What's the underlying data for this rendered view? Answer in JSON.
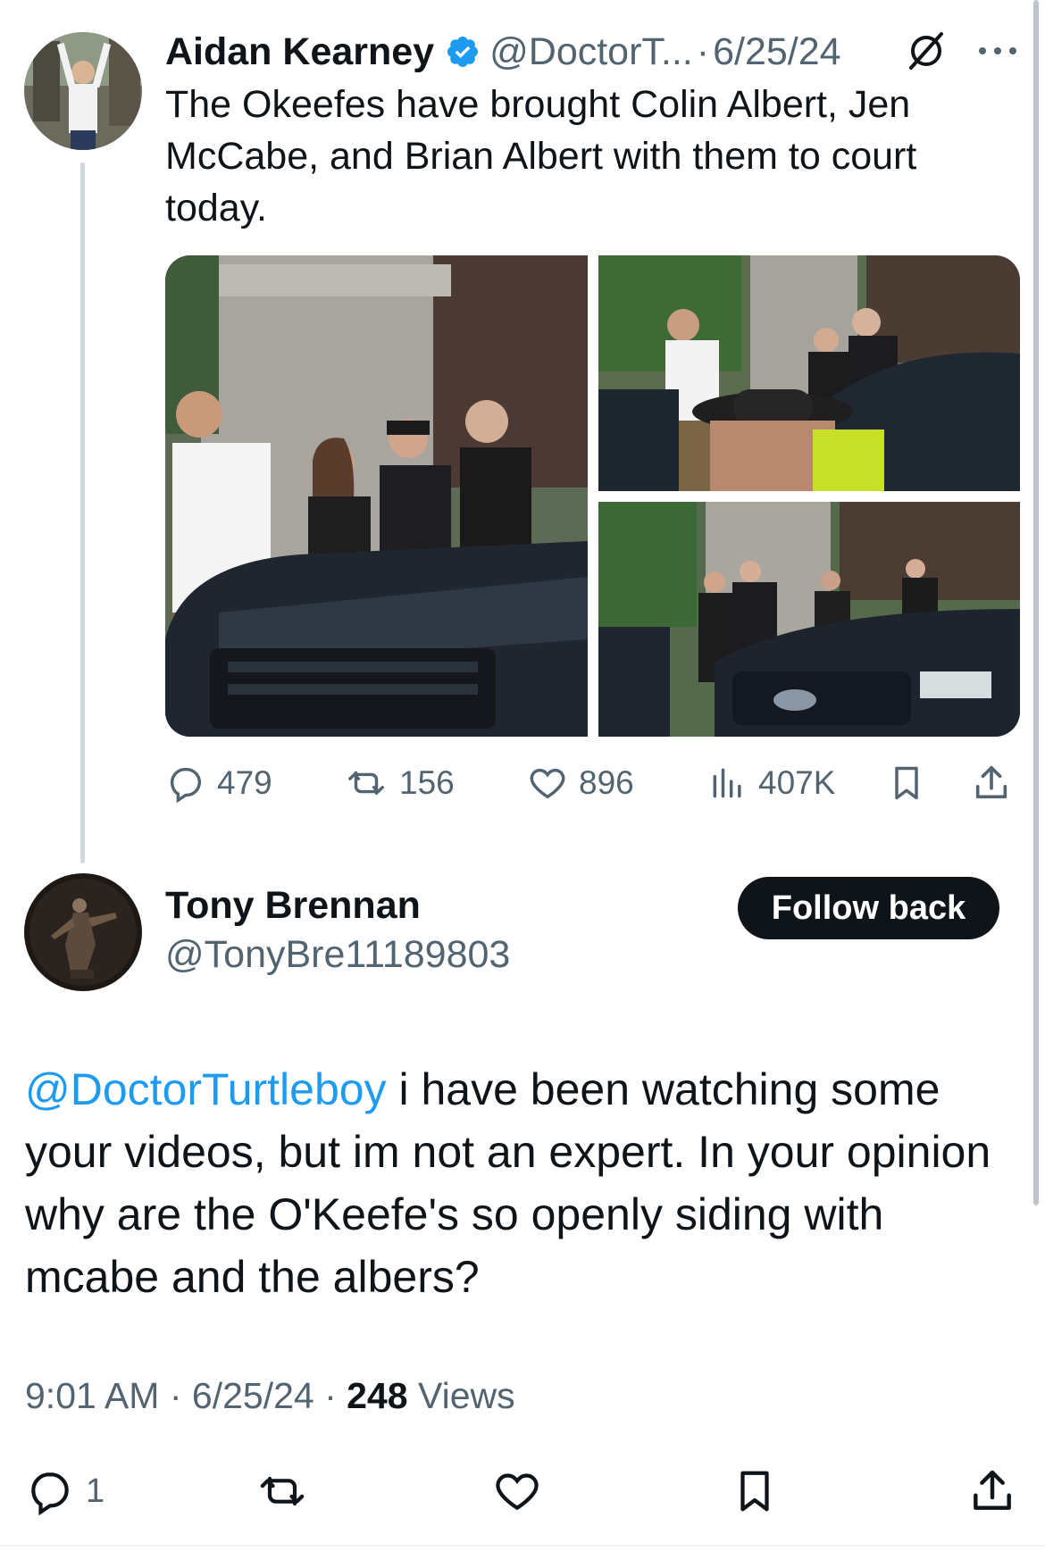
{
  "tweet": {
    "author_name": "Aidan Kearney",
    "handle": "@DoctorT...",
    "separator": "·",
    "date": "6/25/24",
    "text": "The Okeefes have brought Colin Albert, Jen McCabe, and Brian Albert with them to court today.",
    "stats": {
      "replies": "479",
      "reposts": "156",
      "likes": "896",
      "views": "407K"
    }
  },
  "reply": {
    "author_name": "Tony Brennan",
    "handle": "@TonyBre11189803",
    "follow_label": "Follow back",
    "mention": "@DoctorTurtleboy",
    "text": " i have been watching some your videos, but im not an expert. In your opinion why are the O'Keefe's so openly siding with mcabe and the albers?",
    "time": "9:01 AM",
    "date": "6/25/24",
    "separator": "·",
    "views_count": "248",
    "views_label": "Views",
    "reply_count": "1"
  },
  "colors": {
    "text": "#0f1419",
    "secondary": "#536471",
    "accent": "#1d9bf0",
    "button": "#0f1419"
  },
  "icons": [
    "verified-badge-icon",
    "grok-icon",
    "more-icon",
    "reply-icon",
    "repost-icon",
    "like-icon",
    "views-icon",
    "bookmark-icon",
    "share-icon"
  ]
}
